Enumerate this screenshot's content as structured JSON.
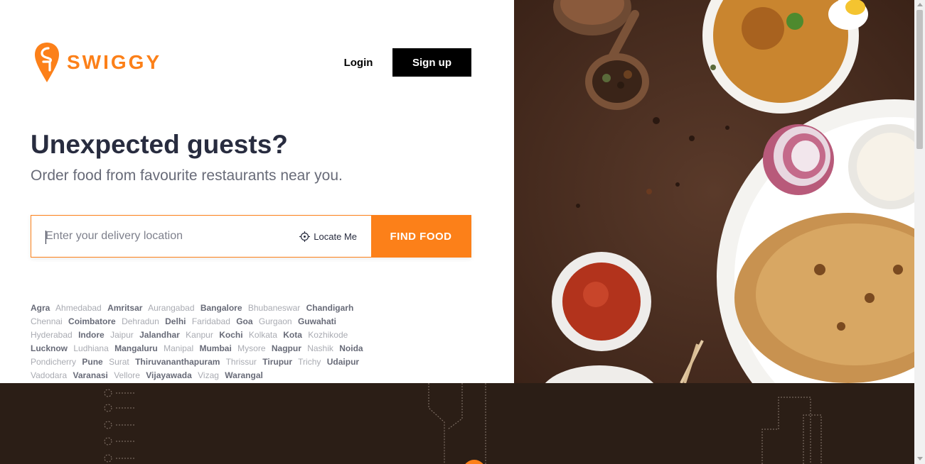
{
  "brand": {
    "name": "SWIGGY",
    "color": "#fc8019",
    "icon": "swiggy-logo-icon"
  },
  "header": {
    "login_label": "Login",
    "signup_label": "Sign up"
  },
  "hero": {
    "title": "Unexpected guests?",
    "subtitle": "Order food from favourite restaurants near you."
  },
  "search": {
    "placeholder": "Enter your delivery location",
    "locate_label": "Locate Me",
    "locate_icon": "crosshair-icon",
    "find_label": "FIND FOOD"
  },
  "cities": [
    {
      "name": "Agra",
      "bold": true
    },
    {
      "name": "Ahmedabad",
      "bold": false
    },
    {
      "name": "Amritsar",
      "bold": true
    },
    {
      "name": "Aurangabad",
      "bold": false
    },
    {
      "name": "Bangalore",
      "bold": true
    },
    {
      "name": "Bhubaneswar",
      "bold": false
    },
    {
      "name": "Chandigarh",
      "bold": true
    },
    {
      "name": "Chennai",
      "bold": false
    },
    {
      "name": "Coimbatore",
      "bold": true
    },
    {
      "name": "Dehradun",
      "bold": false
    },
    {
      "name": "Delhi",
      "bold": true
    },
    {
      "name": "Faridabad",
      "bold": false
    },
    {
      "name": "Goa",
      "bold": true
    },
    {
      "name": "Gurgaon",
      "bold": false
    },
    {
      "name": "Guwahati",
      "bold": true
    },
    {
      "name": "Hyderabad",
      "bold": false
    },
    {
      "name": "Indore",
      "bold": true
    },
    {
      "name": "Jaipur",
      "bold": false
    },
    {
      "name": "Jalandhar",
      "bold": true
    },
    {
      "name": "Kanpur",
      "bold": false
    },
    {
      "name": "Kochi",
      "bold": true
    },
    {
      "name": "Kolkata",
      "bold": false
    },
    {
      "name": "Kota",
      "bold": true
    },
    {
      "name": "Kozhikode",
      "bold": false
    },
    {
      "name": "Lucknow",
      "bold": true
    },
    {
      "name": "Ludhiana",
      "bold": false
    },
    {
      "name": "Mangaluru",
      "bold": true
    },
    {
      "name": "Manipal",
      "bold": false
    },
    {
      "name": "Mumbai",
      "bold": true
    },
    {
      "name": "Mysore",
      "bold": false
    },
    {
      "name": "Nagpur",
      "bold": true
    },
    {
      "name": "Nashik",
      "bold": false
    },
    {
      "name": "Noida",
      "bold": true
    },
    {
      "name": "Pondicherry",
      "bold": false
    },
    {
      "name": "Pune",
      "bold": true
    },
    {
      "name": "Surat",
      "bold": false
    },
    {
      "name": "Thiruvananthapuram",
      "bold": true
    },
    {
      "name": "Thrissur",
      "bold": false
    },
    {
      "name": "Tirupur",
      "bold": true
    },
    {
      "name": "Trichy",
      "bold": false
    },
    {
      "name": "Udaipur",
      "bold": true
    },
    {
      "name": "Vadodara",
      "bold": false
    },
    {
      "name": "Varanasi",
      "bold": true
    },
    {
      "name": "Vellore",
      "bold": false
    },
    {
      "name": "Vijayawada",
      "bold": true
    },
    {
      "name": "Vizag",
      "bold": false
    },
    {
      "name": "Warangal",
      "bold": true
    }
  ]
}
